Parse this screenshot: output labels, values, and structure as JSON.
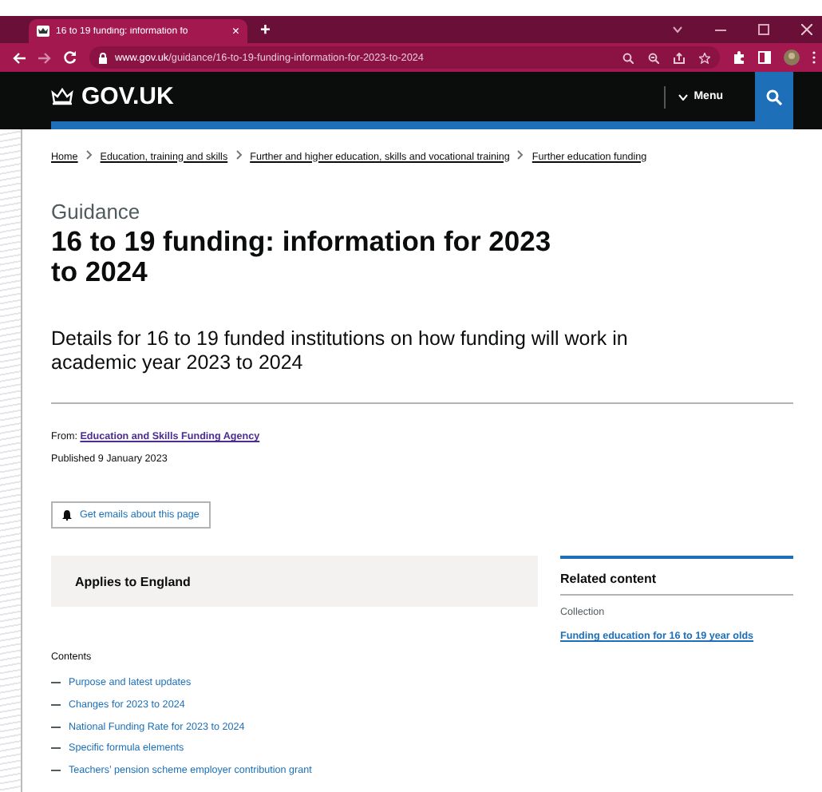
{
  "browser": {
    "tab": {
      "title": "16 to 19 funding: information fo",
      "close": "×",
      "selected": true
    },
    "new_tab": "+",
    "url": {
      "domain": "www.gov.uk",
      "path": "/guidance/16-to-19-funding-information-for-2023-to-2024"
    }
  },
  "header": {
    "logo": "GOV.UK",
    "menu": "Menu"
  },
  "breadcrumbs": [
    "Home",
    "Education, training and skills",
    "Further and higher education, skills and vocational training",
    "Further education funding"
  ],
  "page": {
    "caption": "Guidance",
    "title": "16 to 19 funding: information for 2023 to 2024",
    "description": "Details for 16 to 19 funded institutions on how funding will work in academic year 2023 to 2024",
    "from_label": "From:",
    "from_link": "Education and Skills Funding Agency",
    "published": "Published 9 January 2023",
    "email_button": "Get emails about this page",
    "applies": "Applies to England"
  },
  "contents": {
    "heading": "Contents",
    "items": [
      "Purpose and latest updates",
      "Changes for 2023 to 2024",
      "National Funding Rate for 2023 to 2024",
      "Specific formula elements",
      "Teachers’ pension scheme employer contribution grant"
    ]
  },
  "related": {
    "heading": "Related content",
    "collection_label": "Collection",
    "links": [
      "Funding education for 16 to 19 year olds"
    ]
  }
}
